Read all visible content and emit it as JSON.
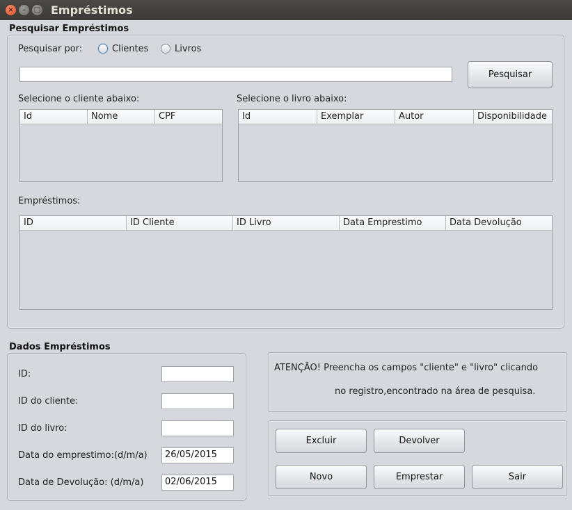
{
  "window": {
    "title": "Empréstimos"
  },
  "search_section": {
    "title": "Pesquisar Empréstimos",
    "search_by_label": "Pesquisar por:",
    "options": [
      {
        "label": "Clientes",
        "selected": true
      },
      {
        "label": "Livros",
        "selected": false
      }
    ],
    "search_value": "",
    "search_button": "Pesquisar",
    "clients_label": "Selecione o cliente abaixo:",
    "clients_columns": [
      "Id",
      "Nome",
      "CPF"
    ],
    "books_label": "Selecione o livro abaixo:",
    "books_columns": [
      "Id",
      "Exemplar",
      "Autor",
      "Disponibilidade"
    ],
    "loans_label": "Empréstimos:",
    "loans_columns": [
      "ID",
      "ID Cliente",
      "ID Livro",
      "Data Emprestimo",
      "Data Devolução"
    ]
  },
  "details_section": {
    "title": "Dados Empréstimos",
    "fields": [
      {
        "label": "ID:",
        "value": ""
      },
      {
        "label": "ID do cliente:",
        "value": ""
      },
      {
        "label": "ID do livro:",
        "value": ""
      },
      {
        "label": "Data do emprestimo:(d/m/a)",
        "value": "26/05/2015"
      },
      {
        "label": "Data de Devolução: (d/m/a)",
        "value": "02/06/2015"
      }
    ]
  },
  "notice": {
    "line1": "ATENÇÃO! Preencha os campos \"cliente\" e \"livro\" clicando",
    "line2": "no registro,encontrado na área de pesquisa."
  },
  "actions": {
    "excluir": "Excluir",
    "devolver": "Devolver",
    "novo": "Novo",
    "emprestar": "Emprestar",
    "sair": "Sair"
  }
}
